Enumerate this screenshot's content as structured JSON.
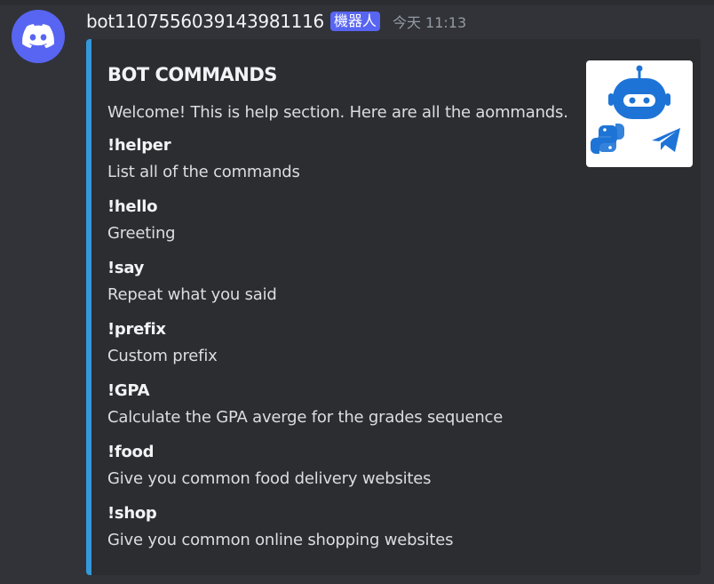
{
  "message": {
    "username": "bot1107556039143981116",
    "bot_tag": "機器人",
    "timestamp": "今天 11:13",
    "avatar_icon": "discord-logo-icon",
    "avatar_color": "#5865f2"
  },
  "embed": {
    "color": "#3498db",
    "title": "BOT COMMANDS",
    "description": "Welcome! This is help section. Here are all the aommands.",
    "thumbnail_icons": [
      "robot-icon",
      "python-icon",
      "telegram-icon"
    ],
    "fields": [
      {
        "name": "!helper",
        "value": "List all of the commands"
      },
      {
        "name": "!hello",
        "value": "Greeting"
      },
      {
        "name": "!say",
        "value": "Repeat what you said"
      },
      {
        "name": "!prefix",
        "value": "Custom prefix"
      },
      {
        "name": "!GPA",
        "value": "Calculate the GPA averge for the grades sequence"
      },
      {
        "name": "!food",
        "value": "Give you common food delivery websites"
      },
      {
        "name": "!shop",
        "value": "Give you common online shopping websites"
      }
    ]
  }
}
